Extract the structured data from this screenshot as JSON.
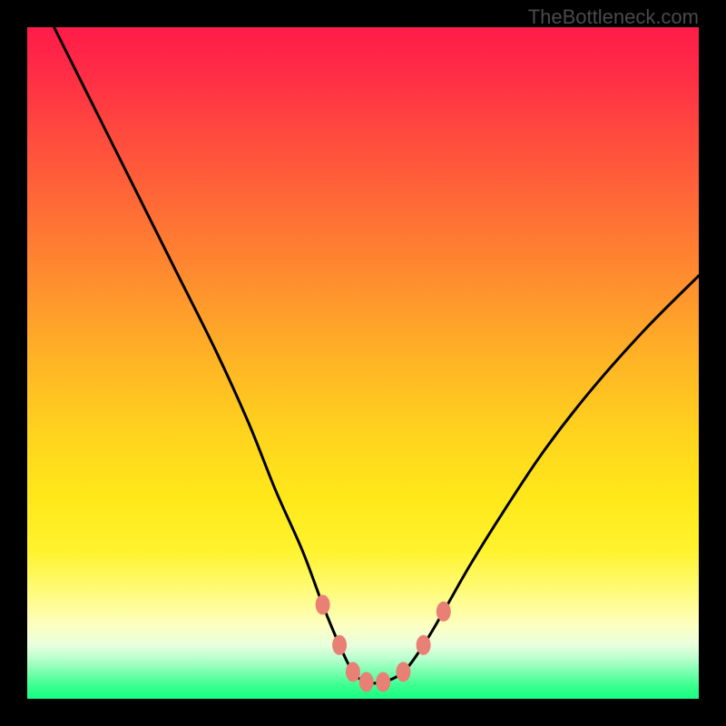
{
  "attribution": "TheBottleneck.com",
  "chart_data": {
    "type": "line",
    "title": "",
    "xlabel": "",
    "ylabel": "",
    "xlim": [
      0,
      100
    ],
    "ylim": [
      0,
      100
    ],
    "series": [
      {
        "name": "bottleneck-curve",
        "x": [
          4,
          10,
          16,
          22,
          28,
          33,
          37,
          41,
          44,
          46.5,
          48.5,
          50.5,
          53,
          56,
          59,
          62,
          66,
          71,
          77,
          84,
          92,
          100
        ],
        "values": [
          100,
          88,
          76,
          64,
          52,
          41,
          31,
          22,
          14,
          8,
          4,
          2.5,
          2.5,
          4,
          8,
          13,
          20,
          28,
          37,
          46,
          55,
          63
        ]
      }
    ],
    "markers": {
      "name": "curve-markers",
      "x": [
        44,
        46.5,
        48.5,
        50.5,
        53,
        56,
        59,
        62
      ],
      "values": [
        14,
        8,
        4,
        2.5,
        2.5,
        4,
        8,
        13
      ],
      "color": "#e98076"
    },
    "gradient_stops": [
      {
        "pos": 0.0,
        "color": "#ff1c49"
      },
      {
        "pos": 0.3,
        "color": "#ff7a32"
      },
      {
        "pos": 0.6,
        "color": "#ffd21e"
      },
      {
        "pos": 0.85,
        "color": "#fffb7a"
      },
      {
        "pos": 0.95,
        "color": "#9affc0"
      },
      {
        "pos": 1.0,
        "color": "#17ff81"
      }
    ]
  }
}
